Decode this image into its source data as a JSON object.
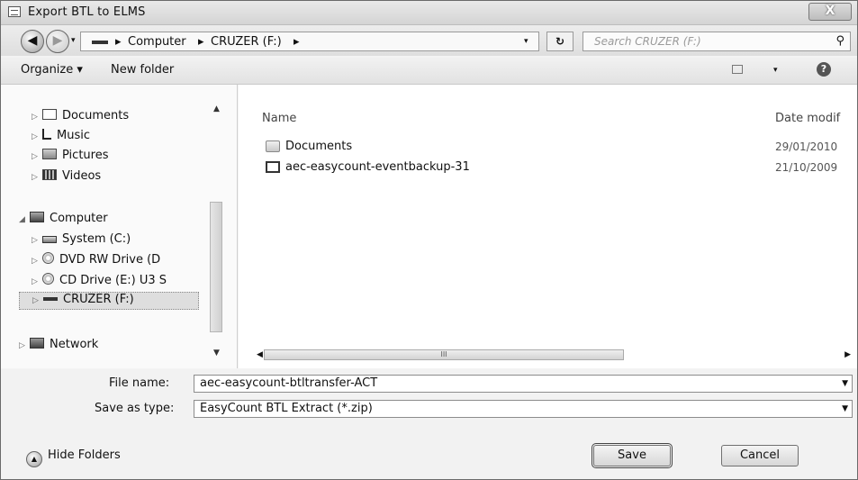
{
  "window": {
    "title": "Export BTL to ELMS",
    "close_glyph": "X"
  },
  "navigation": {
    "back_icon": "back-arrow-icon",
    "forward_icon": "forward-arrow-icon",
    "breadcrumb": [
      "Computer",
      "CRUZER (F:)"
    ],
    "separator": "▸",
    "search_placeholder": "Search CRUZER (F:)",
    "refresh_glyph": "↻"
  },
  "toolbar": {
    "organize": "Organize ▾",
    "new_folder": "New folder",
    "views_arrow": "▾",
    "help": "?"
  },
  "nav_tree": {
    "favorites": [
      {
        "label": "Documents",
        "icon": "documents-icon"
      },
      {
        "label": "Music",
        "icon": "music-icon"
      },
      {
        "label": "Pictures",
        "icon": "pictures-icon"
      },
      {
        "label": "Videos",
        "icon": "videos-icon"
      }
    ],
    "computer": {
      "label": "Computer",
      "icon": "computer-icon"
    },
    "drives": [
      {
        "label": "System (C:)",
        "icon": "hard-drive-icon"
      },
      {
        "label": "DVD RW Drive (D",
        "icon": "dvd-drive-icon"
      },
      {
        "label": "CD Drive (E:) U3 S",
        "icon": "cd-drive-icon"
      },
      {
        "label": "CRUZER (F:)",
        "icon": "usb-drive-icon",
        "selected": true
      }
    ],
    "network": {
      "label": "Network",
      "icon": "network-icon"
    }
  },
  "files": {
    "columns": {
      "name": "Name",
      "date": "Date modif"
    },
    "items": [
      {
        "name": "Documents",
        "date": "29/01/2010",
        "type": "folder",
        "icon": "folder-icon"
      },
      {
        "name": "aec-easycount-eventbackup-31",
        "date": "21/10/2009",
        "type": "file",
        "icon": "file-icon"
      }
    ],
    "hscroll_grip": "III"
  },
  "form": {
    "file_name_label": "File name:",
    "file_name_value": "aec-easycount-btltransfer-ACT",
    "save_type_label": "Save as type:",
    "save_type_value": "EasyCount BTL Extract (*.zip)",
    "hide_folders": "Hide Folders",
    "save": "Save",
    "cancel": "Cancel"
  }
}
